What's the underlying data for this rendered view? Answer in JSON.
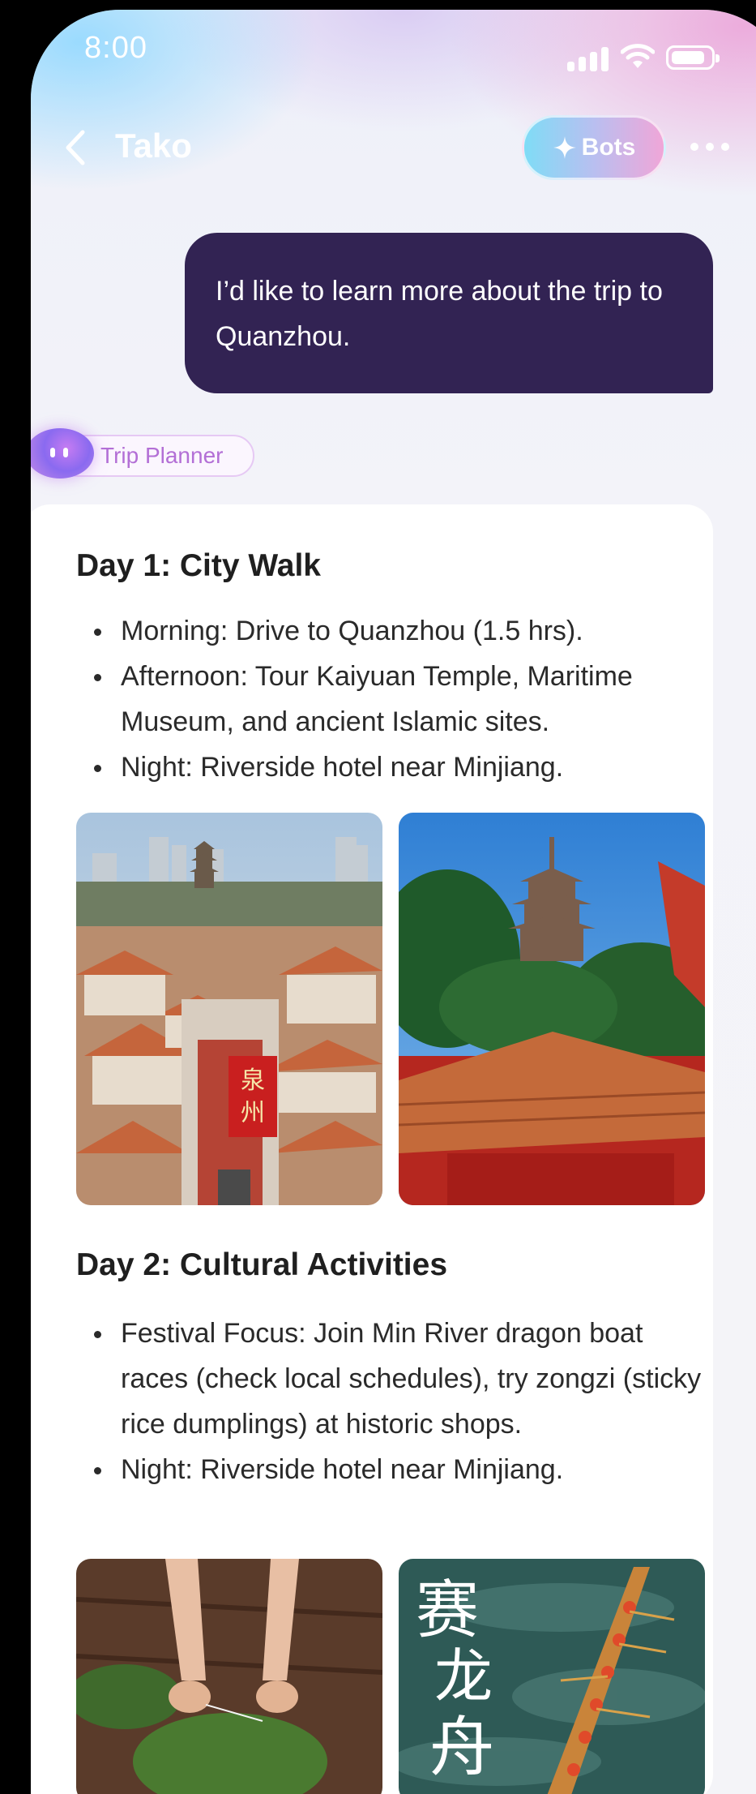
{
  "status_bar": {
    "time": "8:00"
  },
  "header": {
    "title": "Tako",
    "bots_label": "Bots"
  },
  "chat": {
    "user_message": "I’d like to learn more about the trip to Quanzhou.",
    "bot_name": "Trip Planner"
  },
  "itinerary": {
    "day1": {
      "title": "Day 1: City Walk",
      "items": [
        "Morning: Drive to Quanzhou (1.5 hrs).",
        "Afternoon: Tour Kaiyuan Temple, Maritime Museum, and ancient Islamic sites.",
        "Night: Riverside hotel near Minjiang."
      ]
    },
    "day2": {
      "title": "Day 2: Cultural Activities",
      "items": [
        "Festival Focus: Join Min River dragon boat races (check local schedules), try zongzi (sticky rice dumplings) at historic shops.",
        "Night: Riverside hotel near Minjiang."
      ]
    }
  },
  "photos": {
    "city_sign": "泉州",
    "dragon_boat_caption": [
      "赛",
      "龙",
      "舟"
    ]
  },
  "colors": {
    "user_bubble": "#322353",
    "bot_tag_text": "#b36fd6",
    "bots_gradient_start": "#7fdcf6",
    "bots_gradient_end": "#f0a6d8"
  }
}
